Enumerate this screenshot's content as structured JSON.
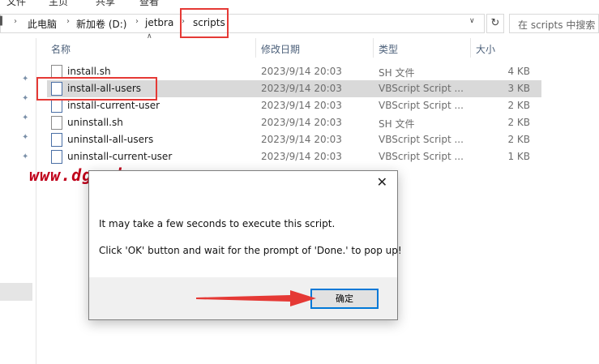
{
  "top_strip": [
    "文件",
    "主页",
    "共享",
    "查看"
  ],
  "address": {
    "crumbs": [
      "此电脑",
      "新加卷 (D:)",
      "jetbra",
      "scripts"
    ],
    "search_placeholder": "在 scripts 中搜索"
  },
  "columns": {
    "name": "名称",
    "date": "修改日期",
    "type": "类型",
    "size": "大小"
  },
  "files": [
    {
      "name": "install.sh",
      "date": "2023/9/14 20:03",
      "type": "SH 文件",
      "size": "4 KB",
      "icon": "document-icon"
    },
    {
      "name": "install-all-users",
      "date": "2023/9/14 20:03",
      "type": "VBScript Script ...",
      "size": "3 KB",
      "icon": "vbscript-icon"
    },
    {
      "name": "install-current-user",
      "date": "2023/9/14 20:03",
      "type": "VBScript Script ...",
      "size": "2 KB",
      "icon": "vbscript-icon"
    },
    {
      "name": "uninstall.sh",
      "date": "2023/9/14 20:03",
      "type": "SH 文件",
      "size": "2 KB",
      "icon": "document-icon"
    },
    {
      "name": "uninstall-all-users",
      "date": "2023/9/14 20:03",
      "type": "VBScript Script ...",
      "size": "2 KB",
      "icon": "vbscript-icon"
    },
    {
      "name": "uninstall-current-user",
      "date": "2023/9/14 20:03",
      "type": "VBScript Script ...",
      "size": "1 KB",
      "icon": "vbscript-icon"
    }
  ],
  "watermark": "www.dgrai.com",
  "dialog": {
    "line1": "It may take a few seconds to execute this script.",
    "line2": "Click 'OK' button and wait for the prompt of 'Done.' to pop up!",
    "ok_label": "确定"
  },
  "colors": {
    "annotation_red": "#e53935",
    "selected_row": "#d9d9d9",
    "watermark": "#c0001a"
  }
}
